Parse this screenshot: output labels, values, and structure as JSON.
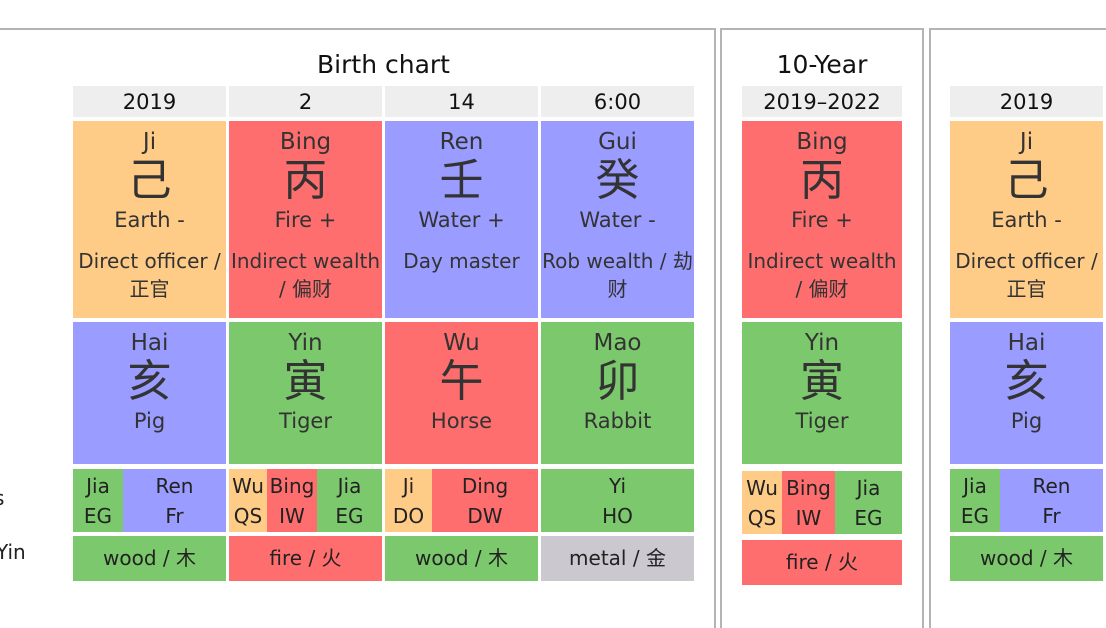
{
  "colors": {
    "earth": "#ffcc88",
    "fire": "#ff6e6e",
    "water": "#9a9cff",
    "wood": "#7cc86c",
    "metal": "#cbc8d0",
    "header": "#eeeeee"
  },
  "row_labels": [
    "s",
    "Yin"
  ],
  "birth_chart": {
    "title": "Birth chart",
    "pillars": [
      {
        "header": "2019",
        "stem": {
          "pinyin": "Ji",
          "char": "己",
          "element": "Earth -",
          "god": "Direct officer / 正官",
          "color": "earth"
        },
        "branch": {
          "pinyin": "Hai",
          "char": "亥",
          "animal": "Pig",
          "color": "water"
        },
        "hidden": [
          {
            "stem": "Jia",
            "god": "EG",
            "color": "wood"
          },
          {
            "stem": "Ren",
            "god": "Fr",
            "color": "water"
          }
        ],
        "nayin": {
          "label": "wood / 木",
          "color": "wood"
        }
      },
      {
        "header": "2",
        "stem": {
          "pinyin": "Bing",
          "char": "丙",
          "element": "Fire +",
          "god": "Indirect wealth / 偏财",
          "color": "fire"
        },
        "branch": {
          "pinyin": "Yin",
          "char": "寅",
          "animal": "Tiger",
          "color": "wood"
        },
        "hidden": [
          {
            "stem": "Wu",
            "god": "QS",
            "color": "earth"
          },
          {
            "stem": "Bing",
            "god": "IW",
            "color": "fire"
          },
          {
            "stem": "Jia",
            "god": "EG",
            "color": "wood"
          }
        ],
        "nayin": {
          "label": "fire / 火",
          "color": "fire"
        }
      },
      {
        "header": "14",
        "stem": {
          "pinyin": "Ren",
          "char": "壬",
          "element": "Water +",
          "god": "Day master",
          "color": "water"
        },
        "branch": {
          "pinyin": "Wu",
          "char": "午",
          "animal": "Horse",
          "color": "fire"
        },
        "hidden": [
          {
            "stem": "Ji",
            "god": "DO",
            "color": "earth"
          },
          {
            "stem": "Ding",
            "god": "DW",
            "color": "fire"
          }
        ],
        "nayin": {
          "label": "wood / 木",
          "color": "wood"
        }
      },
      {
        "header": "6:00",
        "stem": {
          "pinyin": "Gui",
          "char": "癸",
          "element": "Water -",
          "god": "Rob wealth / 劫财",
          "color": "water"
        },
        "branch": {
          "pinyin": "Mao",
          "char": "卯",
          "animal": "Rabbit",
          "color": "wood"
        },
        "hidden": [
          {
            "stem": "Yi",
            "god": "HO",
            "color": "wood"
          }
        ],
        "nayin": {
          "label": "metal / 金",
          "color": "metal"
        }
      }
    ]
  },
  "ten_year": {
    "title": "10-Year",
    "pillar": {
      "header": "2019–2022",
      "stem": {
        "pinyin": "Bing",
        "char": "丙",
        "element": "Fire +",
        "god": "Indirect wealth / 偏财",
        "color": "fire"
      },
      "branch": {
        "pinyin": "Yin",
        "char": "寅",
        "animal": "Tiger",
        "color": "wood"
      },
      "hidden": [
        {
          "stem": "Wu",
          "god": "QS",
          "color": "earth"
        },
        {
          "stem": "Bing",
          "god": "IW",
          "color": "fire"
        },
        {
          "stem": "Jia",
          "god": "EG",
          "color": "wood"
        }
      ],
      "nayin": {
        "label": "fire / 火",
        "color": "fire"
      }
    }
  },
  "annual": {
    "pillar": {
      "header": "2019",
      "stem": {
        "pinyin": "Ji",
        "char": "己",
        "element": "Earth -",
        "god": "Direct officer / 正官",
        "color": "earth"
      },
      "branch": {
        "pinyin": "Hai",
        "char": "亥",
        "animal": "Pig",
        "color": "water"
      },
      "hidden": [
        {
          "stem": "Jia",
          "god": "EG",
          "color": "wood"
        },
        {
          "stem": "Ren",
          "god": "Fr",
          "color": "water"
        }
      ],
      "nayin": {
        "label": "wood / 木",
        "color": "wood"
      }
    }
  }
}
